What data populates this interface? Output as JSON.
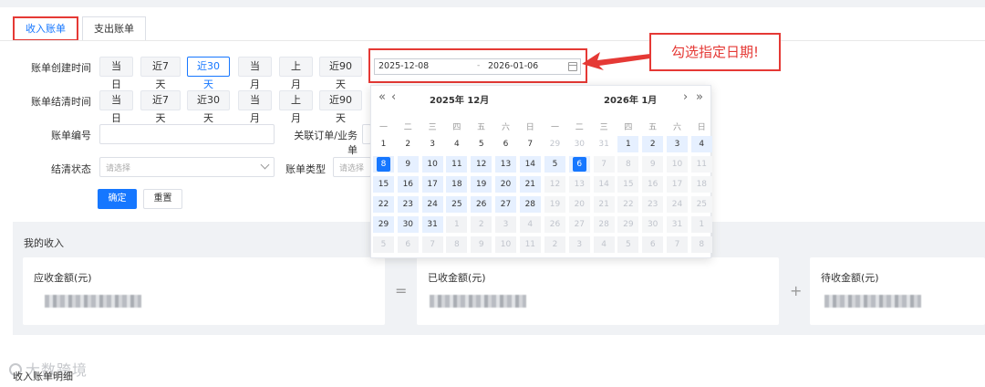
{
  "tabs": [
    {
      "label": "收入账单",
      "active": true
    },
    {
      "label": "支出账单",
      "active": false
    }
  ],
  "filters": {
    "created_label": "账单创建时间",
    "settled_label": "账单结清时间",
    "quick_ranges": [
      "当日",
      "近7天",
      "近30天",
      "当月",
      "上月",
      "近90天"
    ],
    "created_active": "近30天",
    "bill_no_label": "账单编号",
    "order_label": "关联订单/业务单",
    "status_label": "结清状态",
    "status_placeholder": "请选择",
    "type_label": "账单类型",
    "type_placeholder": "请选择",
    "confirm": "确定",
    "reset": "重置"
  },
  "date_range": {
    "start": "2025-12-08",
    "separator": "-",
    "end": "2026-01-06"
  },
  "callout": "勾选指定日期!",
  "calendar": {
    "left_title": "2025年 12月",
    "right_title": "2026年 1月",
    "weekdays": [
      "一",
      "二",
      "三",
      "四",
      "五",
      "六",
      "日"
    ],
    "left_days": [
      [
        "1",
        "2",
        "3",
        "4",
        "5",
        "6",
        "7"
      ],
      [
        "8",
        "9",
        "10",
        "11",
        "12",
        "13",
        "14"
      ],
      [
        "15",
        "16",
        "17",
        "18",
        "19",
        "20",
        "21"
      ],
      [
        "22",
        "23",
        "24",
        "25",
        "26",
        "27",
        "28"
      ],
      [
        "29",
        "30",
        "31",
        "1",
        "2",
        "3",
        "4"
      ],
      [
        "5",
        "6",
        "7",
        "8",
        "9",
        "10",
        "11"
      ]
    ],
    "right_days": [
      [
        "29",
        "30",
        "31",
        "1",
        "2",
        "3",
        "4"
      ],
      [
        "5",
        "6",
        "7",
        "8",
        "9",
        "10",
        "11"
      ],
      [
        "12",
        "13",
        "14",
        "15",
        "16",
        "17",
        "18"
      ],
      [
        "19",
        "20",
        "21",
        "22",
        "23",
        "24",
        "25"
      ],
      [
        "26",
        "27",
        "28",
        "29",
        "30",
        "31",
        "1"
      ],
      [
        "2",
        "3",
        "4",
        "5",
        "6",
        "7",
        "8"
      ]
    ],
    "selected_start": "8",
    "selected_end": "6"
  },
  "income": {
    "title": "我的收入",
    "cards": [
      {
        "label": "应收金额(元)"
      },
      {
        "label": "已收金额(元)"
      },
      {
        "label": "待收金额(元)"
      }
    ],
    "ops": [
      "=",
      "+"
    ]
  },
  "detail_title": "收入账单明细",
  "watermark": "大数跨境",
  "colors": {
    "primary": "#1677ff",
    "highlight": "#e53935",
    "range": "#e6f0ff"
  }
}
